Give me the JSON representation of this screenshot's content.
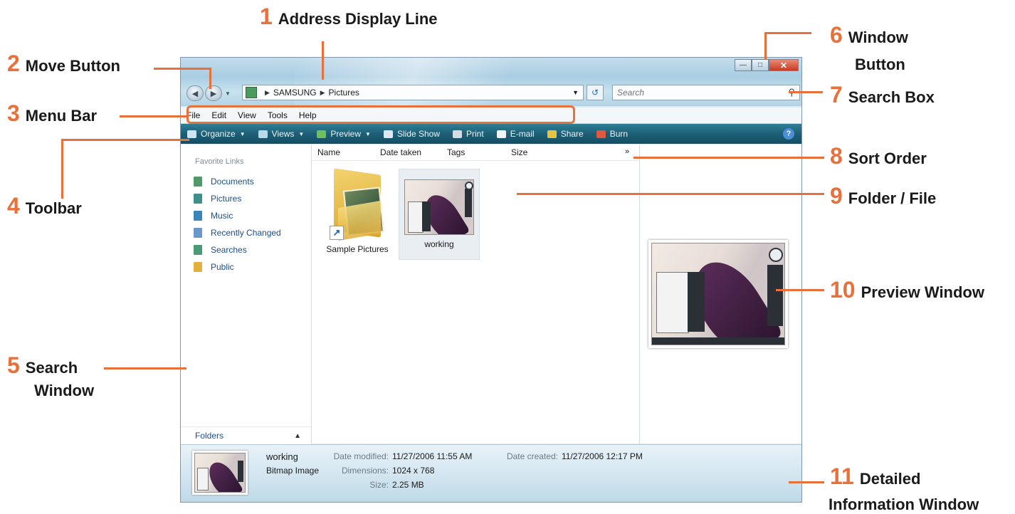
{
  "callouts": [
    {
      "num": "1",
      "label": "Address Display Line"
    },
    {
      "num": "2",
      "label": "Move Button"
    },
    {
      "num": "3",
      "label": "Menu Bar"
    },
    {
      "num": "4",
      "label": "Toolbar"
    },
    {
      "num": "5",
      "label_line1": "Search",
      "label_line2": "Window"
    },
    {
      "num": "6",
      "label_line1": "Window",
      "label_line2": "Button"
    },
    {
      "num": "7",
      "label": "Search Box"
    },
    {
      "num": "8",
      "label": "Sort Order"
    },
    {
      "num": "9",
      "label": "Folder / File"
    },
    {
      "num": "10",
      "label": "Preview Window"
    },
    {
      "num": "11",
      "label_line1": "Detailed",
      "label_line2": "Information Window"
    }
  ],
  "address": {
    "crumbs": [
      "SAMSUNG",
      "Pictures"
    ]
  },
  "search": {
    "placeholder": "Search"
  },
  "menu": [
    "File",
    "Edit",
    "View",
    "Tools",
    "Help"
  ],
  "toolbar": [
    {
      "label": "Organize",
      "color": "#cfe6f0",
      "dropdown": true
    },
    {
      "label": "Views",
      "color": "#bcd6ea",
      "dropdown": true
    },
    {
      "label": "Preview",
      "color": "#6fbf5a",
      "dropdown": true
    },
    {
      "label": "Slide Show",
      "color": "#dfe8f0",
      "dropdown": false
    },
    {
      "label": "Print",
      "color": "#d5dde4",
      "dropdown": false
    },
    {
      "label": "E-mail",
      "color": "#f0f4f6",
      "dropdown": false
    },
    {
      "label": "Share",
      "color": "#e8c243",
      "dropdown": false
    },
    {
      "label": "Burn",
      "color": "#e0583f",
      "dropdown": false
    }
  ],
  "favorites": {
    "title": "Favorite Links",
    "items": [
      {
        "label": "Documents",
        "color": "#4e9a6a"
      },
      {
        "label": "Pictures",
        "color": "#3f8f8a"
      },
      {
        "label": "Music",
        "color": "#3a86b8"
      },
      {
        "label": "Recently Changed",
        "color": "#6a98c8"
      },
      {
        "label": "Searches",
        "color": "#4a9a77"
      },
      {
        "label": "Public",
        "color": "#e3b23c"
      }
    ],
    "folders_label": "Folders"
  },
  "columns": [
    "Name",
    "Date taken",
    "Tags",
    "Size"
  ],
  "files": [
    {
      "name": "Sample Pictures",
      "kind": "folder-shortcut"
    },
    {
      "name": "working",
      "kind": "image",
      "selected": true
    }
  ],
  "details": {
    "name": "working",
    "type": "Bitmap Image",
    "modified_label": "Date modified:",
    "modified": "11/27/2006 11:55 AM",
    "dimensions_label": "Dimensions:",
    "dimensions": "1024 x 768",
    "size_label": "Size:",
    "size": "2.25 MB",
    "created_label": "Date created:",
    "created": "11/27/2006 12:17 PM"
  }
}
